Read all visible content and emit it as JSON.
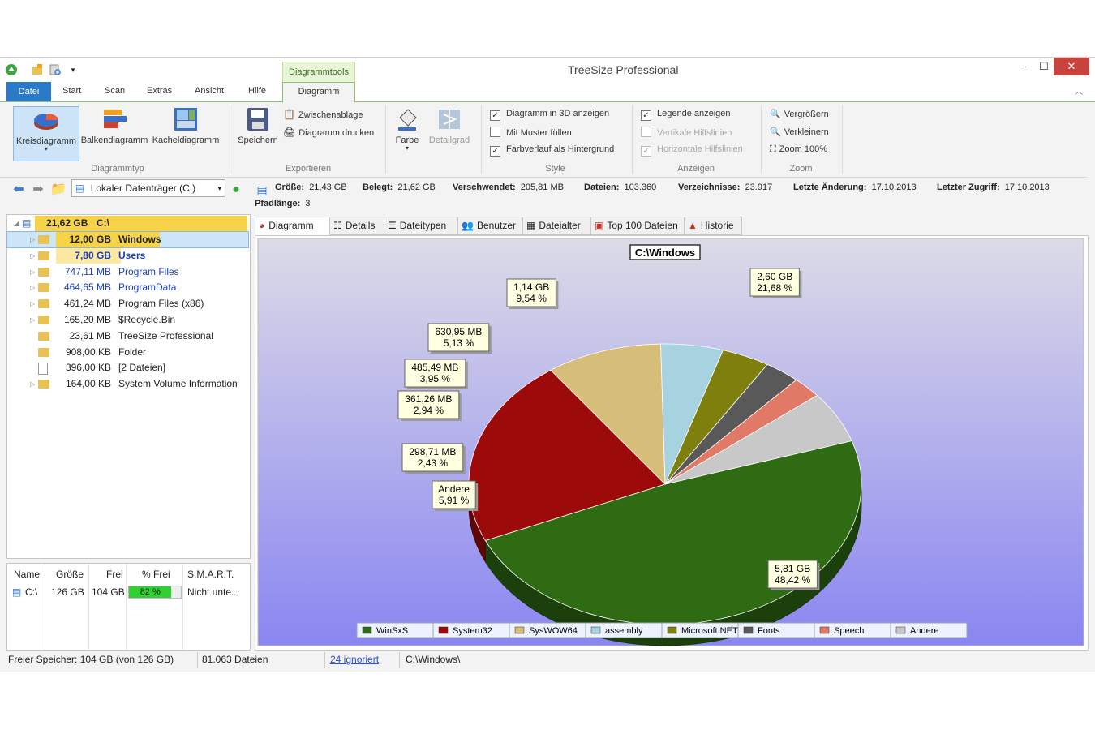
{
  "app": {
    "title": "TreeSize Professional",
    "context_tab_group": "Diagrammtools"
  },
  "colors": {
    "accent": "#2b79c9",
    "context_green": "#8fc26a",
    "close_red": "#c7433b"
  },
  "ribbon": {
    "tabs": [
      "Datei",
      "Start",
      "Scan",
      "Extras",
      "Ansicht",
      "Hilfe",
      "Diagramm"
    ],
    "diagrammtyp": {
      "group_label": "Diagrammtyp",
      "pie": "Kreisdiagramm",
      "bar": "Balkendiagramm",
      "tile": "Kacheldiagramm"
    },
    "exportieren": {
      "group_label": "Exportieren",
      "save": "Speichern",
      "clipboard": "Zwischenablage",
      "print": "Diagramm drucken"
    },
    "style": {
      "group_label": "Style",
      "color": "Farbe",
      "detail": "Detailgrad",
      "opt_3d": "Diagramm in 3D anzeigen",
      "opt_3d_checked": true,
      "opt_pattern": "Mit Muster füllen",
      "opt_pattern_checked": false,
      "opt_gradient": "Farbverlauf als Hintergrund",
      "opt_gradient_checked": true
    },
    "anzeigen": {
      "group_label": "Anzeigen",
      "legend": "Legende anzeigen",
      "legend_checked": true,
      "vlines": "Vertikale Hilfslinien",
      "vlines_checked": false,
      "hlines": "Horizontale Hilfslinien",
      "hlines_checked": true
    },
    "zoom": {
      "group_label": "Zoom",
      "in": "Vergrößern",
      "out": "Verkleinern",
      "reset": "Zoom 100%"
    }
  },
  "navbar": {
    "drive": "Lokaler Datenträger (C:)",
    "info": [
      {
        "label": "Größe:",
        "value": "21,43 GB"
      },
      {
        "label": "Belegt:",
        "value": "21,62 GB"
      },
      {
        "label": "Verschwendet:",
        "value": "205,81 MB"
      },
      {
        "label": "Dateien:",
        "value": "103.360"
      },
      {
        "label": "Verzeichnisse:",
        "value": "23.917"
      },
      {
        "label": "Letzte Änderung:",
        "value": "17.10.2013"
      },
      {
        "label": "Letzter Zugriff:",
        "value": "17.10.2013"
      }
    ],
    "path_length_label": "Pfadlänge:",
    "path_length": "3"
  },
  "tree": {
    "root": {
      "size": "21,62 GB",
      "name": "C:\\"
    },
    "items": [
      {
        "size": "12,00 GB",
        "name": "Windows"
      },
      {
        "size": "7,80 GB",
        "name": "Users"
      },
      {
        "size": "747,11 MB",
        "name": "Program Files"
      },
      {
        "size": "464,65 MB",
        "name": "ProgramData"
      },
      {
        "size": "461,24 MB",
        "name": "Program Files (x86)"
      },
      {
        "size": "165,20 MB",
        "name": "$Recycle.Bin"
      },
      {
        "size": "23,61 MB",
        "name": "TreeSize Professional"
      },
      {
        "size": "908,00 KB",
        "name": "Folder"
      },
      {
        "size": "396,00 KB",
        "name": "[2 Dateien]"
      },
      {
        "size": "164,00 KB",
        "name": "System Volume Information"
      }
    ]
  },
  "drives": {
    "headers": [
      "Name",
      "Größe",
      "Frei",
      "% Frei",
      "S.M.A.R.T."
    ],
    "row": {
      "name": "C:\\",
      "size": "126 GB",
      "free": "104 GB",
      "pct_free": "82 %",
      "pct_value": 82,
      "smart": "Nicht unte..."
    }
  },
  "status": {
    "free": "Freier Speicher: 104 GB  (von 126 GB)",
    "files": "81.063  Dateien",
    "ignored": "24 ignoriert",
    "path": "C:\\Windows\\"
  },
  "view_tabs": [
    "Diagramm",
    "Details",
    "Dateitypen",
    "Benutzer",
    "Dateialter",
    "Top 100 Dateien",
    "Historie"
  ],
  "chart_data": {
    "type": "pie",
    "title": "C:\\Windows",
    "slices": [
      {
        "name": "WinSxS",
        "value": 48.42,
        "label": "5,81 GB\n48,42 %",
        "color": "#2e6b12"
      },
      {
        "name": "System32",
        "value": 21.68,
        "label": "2,60 GB\n21,68 %",
        "color": "#9c0a0a"
      },
      {
        "name": "SysWOW64",
        "value": 9.54,
        "label": "1,14 GB\n9,54 %",
        "color": "#d6bd7a"
      },
      {
        "name": "assembly",
        "value": 5.13,
        "label": "630,95 MB\n5,13 %",
        "color": "#a6d3df"
      },
      {
        "name": "Microsoft.NET",
        "value": 3.95,
        "label": "485,49 MB\n3,95 %",
        "color": "#7f7f0e"
      },
      {
        "name": "Fonts",
        "value": 2.94,
        "label": "361,26 MB\n2,94 %",
        "color": "#595959"
      },
      {
        "name": "Speech",
        "value": 2.43,
        "label": "298,71 MB\n2,43 %",
        "color": "#e07a66"
      },
      {
        "name": "Andere",
        "value": 5.91,
        "label": "Andere\n5,91 %",
        "color": "#c8c8c8"
      }
    ],
    "legend": "bottom",
    "background": "gradient"
  }
}
